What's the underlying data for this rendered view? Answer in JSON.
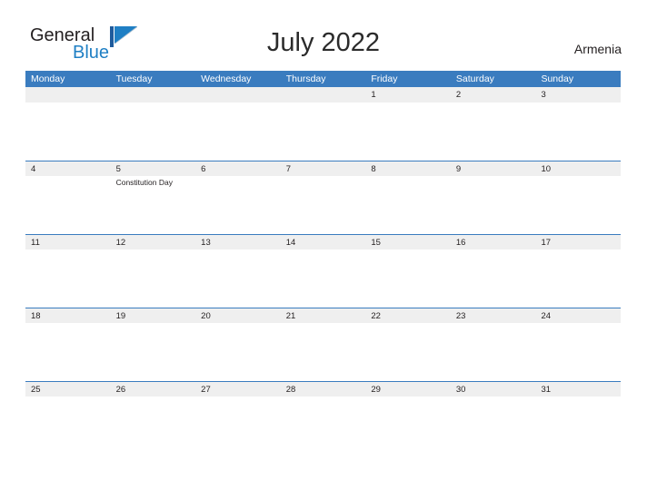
{
  "brand": {
    "name_part1": "General",
    "name_part2": "Blue",
    "flag_icon": "triangle-flag-icon",
    "primary_color": "#3a7cbf",
    "text_color": "#231f20"
  },
  "header": {
    "title": "July 2022",
    "country": "Armenia"
  },
  "calendar": {
    "weekdays": [
      "Monday",
      "Tuesday",
      "Wednesday",
      "Thursday",
      "Friday",
      "Saturday",
      "Sunday"
    ],
    "header_bg": "#3a7cbf",
    "date_band_bg": "#efefef",
    "cell_bg": "#ffffff",
    "weeks": [
      {
        "days": [
          {
            "num": "",
            "event": ""
          },
          {
            "num": "",
            "event": ""
          },
          {
            "num": "",
            "event": ""
          },
          {
            "num": "",
            "event": ""
          },
          {
            "num": "1",
            "event": ""
          },
          {
            "num": "2",
            "event": ""
          },
          {
            "num": "3",
            "event": ""
          }
        ]
      },
      {
        "days": [
          {
            "num": "4",
            "event": ""
          },
          {
            "num": "5",
            "event": "Constitution Day"
          },
          {
            "num": "6",
            "event": ""
          },
          {
            "num": "7",
            "event": ""
          },
          {
            "num": "8",
            "event": ""
          },
          {
            "num": "9",
            "event": ""
          },
          {
            "num": "10",
            "event": ""
          }
        ]
      },
      {
        "days": [
          {
            "num": "11",
            "event": ""
          },
          {
            "num": "12",
            "event": ""
          },
          {
            "num": "13",
            "event": ""
          },
          {
            "num": "14",
            "event": ""
          },
          {
            "num": "15",
            "event": ""
          },
          {
            "num": "16",
            "event": ""
          },
          {
            "num": "17",
            "event": ""
          }
        ]
      },
      {
        "days": [
          {
            "num": "18",
            "event": ""
          },
          {
            "num": "19",
            "event": ""
          },
          {
            "num": "20",
            "event": ""
          },
          {
            "num": "21",
            "event": ""
          },
          {
            "num": "22",
            "event": ""
          },
          {
            "num": "23",
            "event": ""
          },
          {
            "num": "24",
            "event": ""
          }
        ]
      },
      {
        "days": [
          {
            "num": "25",
            "event": ""
          },
          {
            "num": "26",
            "event": ""
          },
          {
            "num": "27",
            "event": ""
          },
          {
            "num": "28",
            "event": ""
          },
          {
            "num": "29",
            "event": ""
          },
          {
            "num": "30",
            "event": ""
          },
          {
            "num": "31",
            "event": ""
          }
        ]
      }
    ]
  }
}
